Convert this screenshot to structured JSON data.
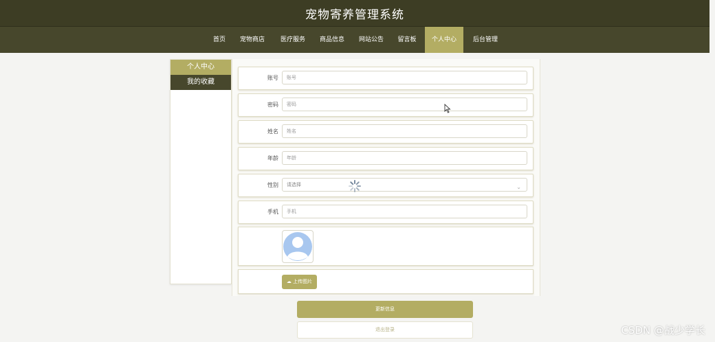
{
  "header": {
    "title": "宠物寄养管理系统"
  },
  "nav": {
    "items": [
      {
        "label": "首页"
      },
      {
        "label": "宠物商店"
      },
      {
        "label": "医疗服务"
      },
      {
        "label": "商品信息"
      },
      {
        "label": "网站公告"
      },
      {
        "label": "留言板"
      },
      {
        "label": "个人中心",
        "active": true
      },
      {
        "label": "后台管理"
      }
    ]
  },
  "sidebar": {
    "items": [
      {
        "label": "个人中心",
        "active": true
      },
      {
        "label": "我的收藏"
      }
    ]
  },
  "form": {
    "account": {
      "label": "账号",
      "placeholder": "账号"
    },
    "password": {
      "label": "密码",
      "placeholder": "密码"
    },
    "name": {
      "label": "姓名",
      "placeholder": "姓名"
    },
    "age": {
      "label": "年龄",
      "placeholder": "年龄"
    },
    "gender": {
      "label": "性别",
      "placeholder": "请选择"
    },
    "phone": {
      "label": "手机",
      "placeholder": "手机"
    },
    "upload_label": "上传图片",
    "update_button": "更新信息",
    "logout_button": "退出登录"
  },
  "watermark": "CSDN @战少学长",
  "colors": {
    "header_bg": "#3d3d24",
    "nav_bg": "#47472c",
    "accent": "#b3ad63"
  },
  "icons": {
    "avatar": "default-user-avatar-icon",
    "upload": "upload-cloud-icon",
    "cursor": "mouse-pointer-icon",
    "loading": "loading-spinner-icon"
  }
}
